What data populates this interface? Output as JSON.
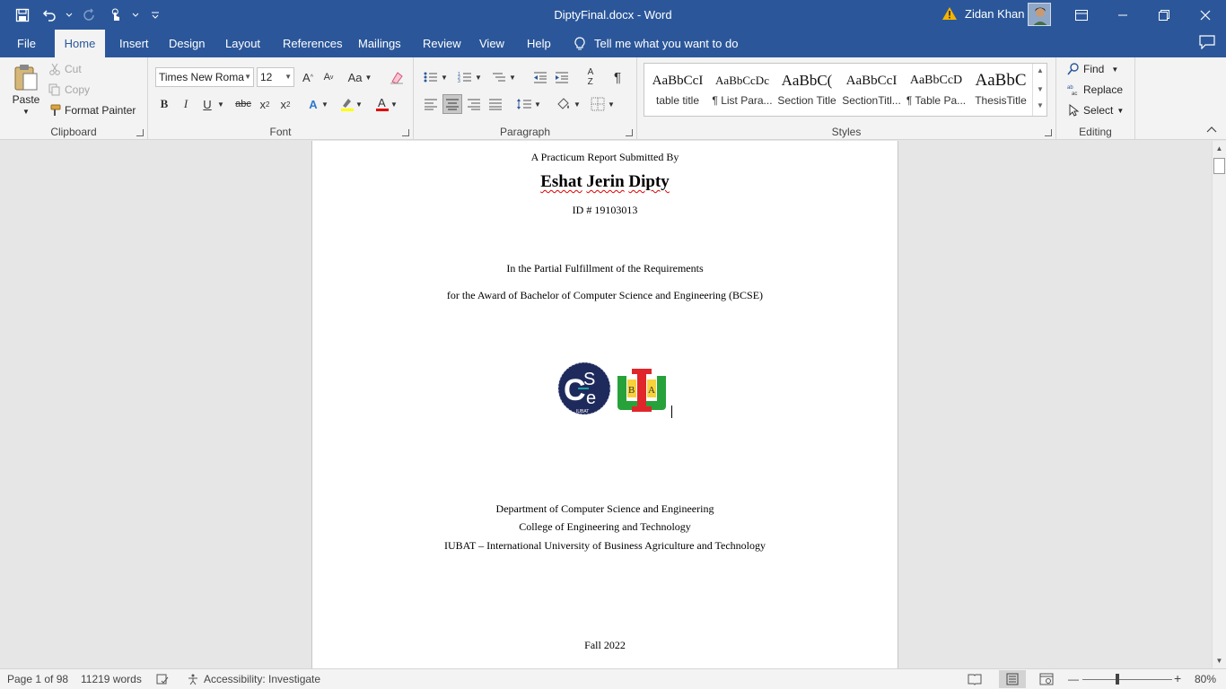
{
  "window": {
    "title": "DiptyFinal.docx  -  Word",
    "user_name": "Zidan Khan"
  },
  "tabs": [
    "File",
    "Home",
    "Insert",
    "Design",
    "Layout",
    "References",
    "Mailings",
    "Review",
    "View",
    "Help"
  ],
  "active_tab": "Home",
  "tell_me": "Tell me what you want to do",
  "ribbon": {
    "clipboard": {
      "label": "Clipboard",
      "paste": "Paste",
      "cut": "Cut",
      "copy": "Copy",
      "format_painter": "Format Painter"
    },
    "font": {
      "label": "Font",
      "font_name": "Times New Roma",
      "font_size": "12"
    },
    "paragraph": {
      "label": "Paragraph"
    },
    "styles": {
      "label": "Styles",
      "items": [
        {
          "sample": "AaBbCcI",
          "name": "table title"
        },
        {
          "sample": "AaBbCcDc",
          "name": "¶ List Para..."
        },
        {
          "sample": "AaBbC(",
          "name": "Section Title"
        },
        {
          "sample": "AaBbCcI",
          "name": "SectionTitl..."
        },
        {
          "sample": "AaBbCcD",
          "name": "¶ Table Pa..."
        },
        {
          "sample": "AaBbC",
          "name": "ThesisTitle"
        }
      ]
    },
    "editing": {
      "label": "Editing",
      "find": "Find",
      "replace": "Replace",
      "select": "Select"
    }
  },
  "document": {
    "line1": "A Practicum Report Submitted By",
    "author_first": "Eshat",
    "author_middle": "Jerin",
    "author_last": "Dipty",
    "id_line": "ID # 19103013",
    "fulfillment": "In the Partial Fulfillment of the Requirements",
    "award": "for the Award of Bachelor of Computer Science and Engineering (BCSE)",
    "dept": "Department of Computer Science and Engineering",
    "college": "College of Engineering and Technology",
    "university": "IUBAT – International University of Business Agriculture and Technology",
    "term": "Fall 2022",
    "logos": {
      "cse_text": "IUBAT",
      "iubat_b": "B",
      "iubat_a": "A"
    }
  },
  "status": {
    "page": "Page 1 of 98",
    "words": "11219 words",
    "accessibility": "Accessibility: Investigate",
    "zoom": "80%"
  },
  "colors": {
    "word_blue": "#2b579a",
    "ribbon_bg": "#f3f3f3"
  }
}
